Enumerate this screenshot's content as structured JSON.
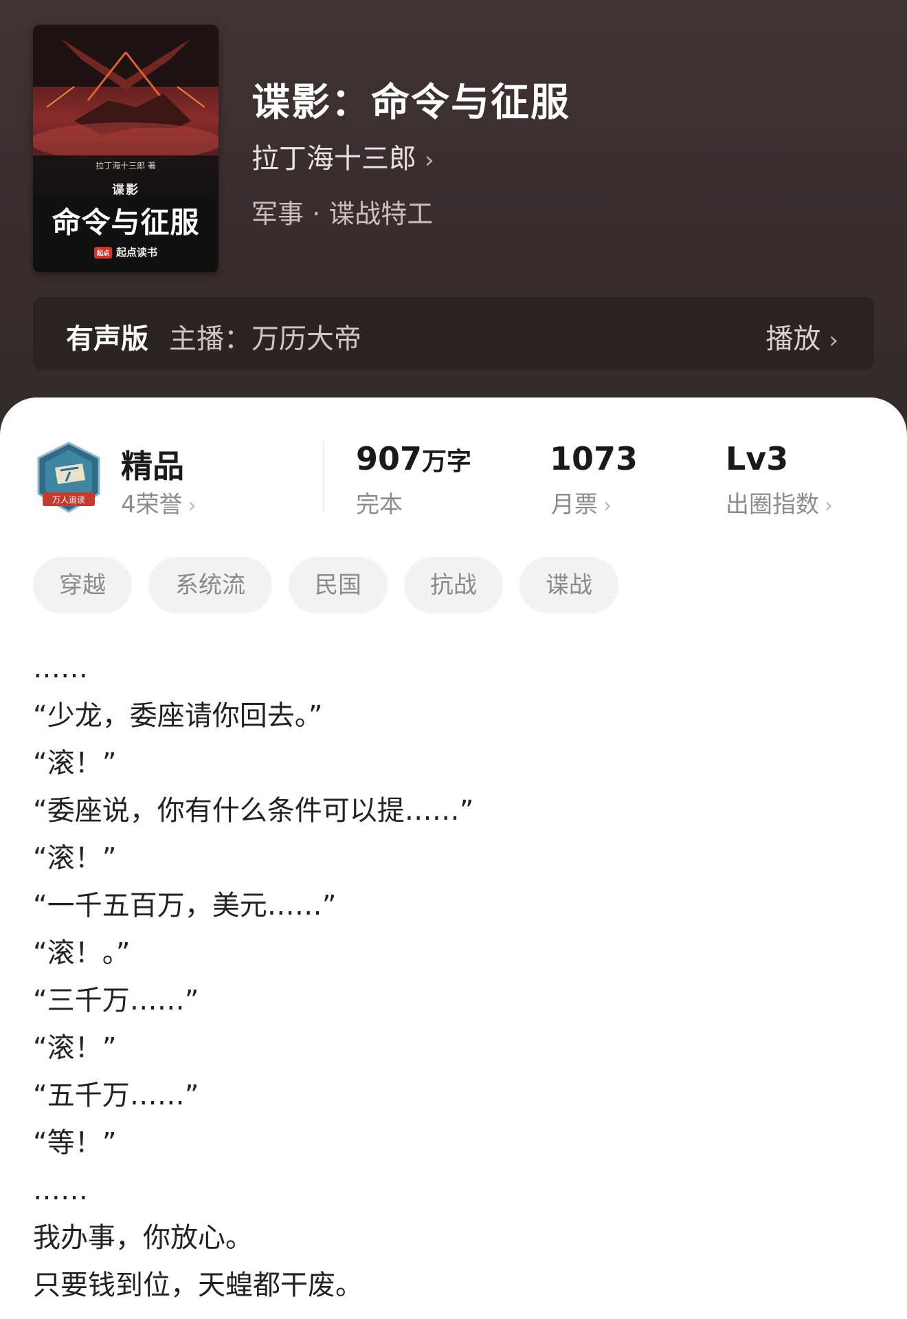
{
  "book": {
    "title": "谍影：命令与征服",
    "author": "拉丁海十三郎",
    "genre": "军事 · 谍战特工",
    "cover": {
      "author_line": "拉丁海十三郎 著",
      "subtitle": "谍影",
      "title": "命令与征服",
      "publisher_logo": "起点",
      "publisher": "起点读书"
    }
  },
  "audio": {
    "tag": "有声版",
    "host": "主播：万历大帝",
    "play": "播放"
  },
  "stats": {
    "badge_text": "万人追读",
    "quality": "精品",
    "honors": "4荣誉",
    "word_count": "907",
    "word_unit": "万字",
    "status": "完本",
    "monthly_votes": "1073",
    "monthly_label": "月票",
    "level": "Lv3",
    "level_label": "出圈指数"
  },
  "tags": [
    "穿越",
    "系统流",
    "民国",
    "抗战",
    "谍战"
  ],
  "synopsis": [
    "……",
    "“少龙，委座请你回去。”",
    "“滚！”",
    "“委座说，你有什么条件可以提……”",
    "“滚！”",
    "“一千五百万，美元……”",
    "“滚！。”",
    "“三千万……”",
    "“滚！”",
    "“五千万……”",
    "“等！”",
    "……",
    "我办事，你放心。",
    "只要钱到位，天蝗都干废。"
  ],
  "colors": {
    "header_bg": "#3a2f30",
    "audio_bar_bg": "#2a2424",
    "tag_bg": "#f2f2f2",
    "badge_red": "#c73a2e",
    "badge_teal": "#2f6a86"
  }
}
